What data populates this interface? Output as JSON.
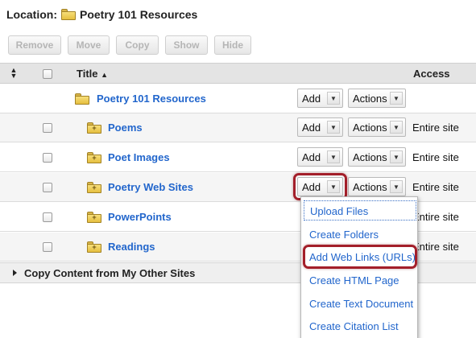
{
  "location": {
    "label": "Location:",
    "folder_name": "Poetry 101 Resources"
  },
  "toolbar": {
    "remove": "Remove",
    "move": "Move",
    "copy": "Copy",
    "show": "Show",
    "hide": "Hide"
  },
  "table": {
    "title_header": "Title",
    "access_header": "Access"
  },
  "rows": [
    {
      "name": "Poetry 101 Resources",
      "add": "Add",
      "actions": "Actions",
      "access": ""
    },
    {
      "name": "Poems",
      "add": "Add",
      "actions": "Actions",
      "access": "Entire site"
    },
    {
      "name": "Poet Images",
      "add": "Add",
      "actions": "Actions",
      "access": "Entire site"
    },
    {
      "name": "Poetry Web Sites",
      "add": "Add",
      "actions": "Actions",
      "access": "Entire site"
    },
    {
      "name": "PowerPoints",
      "add": "",
      "actions": "",
      "access": "Entire site"
    },
    {
      "name": "Readings",
      "add": "",
      "actions": "",
      "access": "Entire site"
    }
  ],
  "copy_section": {
    "label": "Copy Content from My Other Sites"
  },
  "add_menu": {
    "items": [
      "Upload Files",
      "Create Folders",
      "Add Web Links (URLs)",
      "Create HTML Page",
      "Create Text Document",
      "Create Citation List"
    ]
  },
  "colors": {
    "link": "#2266cc",
    "highlight": "#a31f2a",
    "folder": "#e6bf3f"
  }
}
